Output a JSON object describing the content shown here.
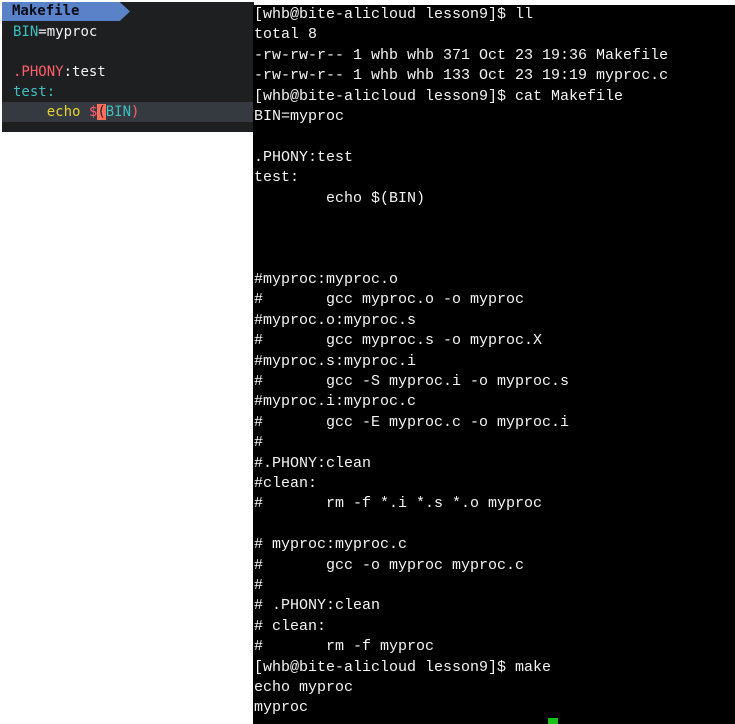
{
  "vim": {
    "tab_label": "Makefile",
    "line1": {
      "var": "BIN",
      "eq": "=",
      "val": "myproc"
    },
    "line2": "",
    "line3": {
      "target": ".PHONY",
      "colon": ":",
      "dep": "test"
    },
    "line4": {
      "target": "test:"
    },
    "line5": {
      "indent": "    ",
      "cmd": "echo",
      "sp": " ",
      "dollar": "$",
      "paren_open": "(",
      "var": "BIN",
      "paren_close": ")"
    }
  },
  "terminal": {
    "lines": [
      "[whb@bite-alicloud lesson9]$ ll",
      "total 8",
      "-rw-rw-r-- 1 whb whb 371 Oct 23 19:36 Makefile",
      "-rw-rw-r-- 1 whb whb 133 Oct 23 19:19 myproc.c",
      "[whb@bite-alicloud lesson9]$ cat Makefile",
      "BIN=myproc",
      "",
      ".PHONY:test",
      "test:",
      "        echo $(BIN)",
      "",
      "",
      "",
      "#myproc:myproc.o",
      "#       gcc myproc.o -o myproc",
      "#myproc.o:myproc.s",
      "#       gcc myproc.s -o myproc.X",
      "#myproc.s:myproc.i",
      "#       gcc -S myproc.i -o myproc.s",
      "#myproc.i:myproc.c",
      "#       gcc -E myproc.c -o myproc.i",
      "#",
      "#.PHONY:clean",
      "#clean:",
      "#       rm -f *.i *.s *.o myproc",
      "",
      "# myproc:myproc.c",
      "#       gcc -o myproc myproc.c",
      "#",
      "# .PHONY:clean",
      "# clean:",
      "#       rm -f myproc",
      "[whb@bite-alicloud lesson9]$ make",
      "echo myproc",
      "myproc"
    ]
  }
}
